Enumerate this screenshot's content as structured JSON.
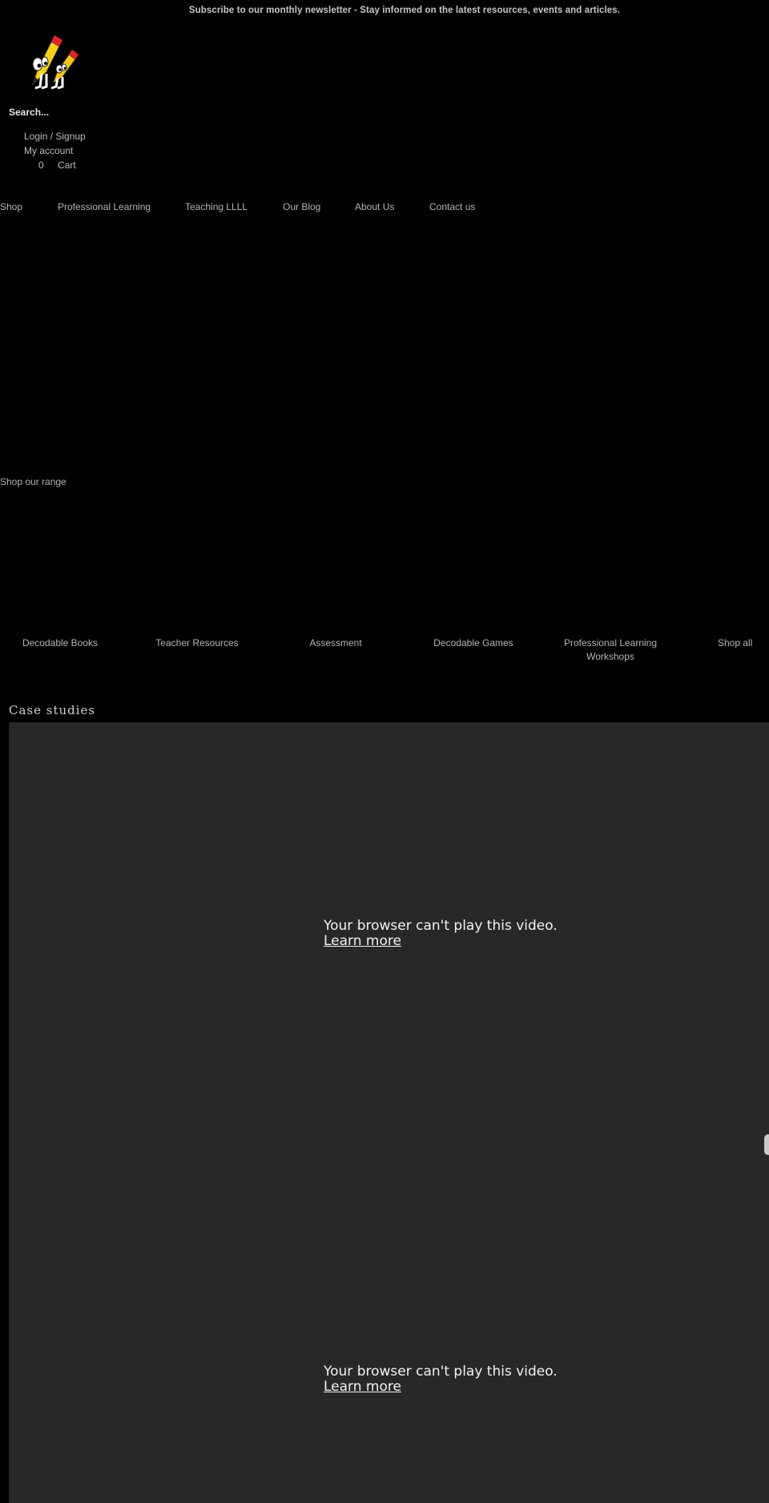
{
  "announcement": {
    "text": "Subscribe to our monthly newsletter - Stay informed on the latest resources, events and articles."
  },
  "header": {
    "logo_icon": "pencil-characters-logo",
    "search_label": "Search...",
    "login_label": "Login / Signup",
    "account_label": "My account",
    "cart_count": "0",
    "cart_label": "Cart"
  },
  "nav": {
    "items": [
      {
        "label": "Shop"
      },
      {
        "label": "Professional Learning"
      },
      {
        "label": "Teaching LLLL"
      },
      {
        "label": "Our Blog"
      },
      {
        "label": "About Us"
      },
      {
        "label": "Contact us"
      }
    ]
  },
  "shop_section": {
    "heading": "Shop our range",
    "ranges": [
      {
        "label": "Decodable Books"
      },
      {
        "label": "Teacher Resources"
      },
      {
        "label": "Assessment"
      },
      {
        "label": "Decodable Games"
      },
      {
        "label": "Professional Learning Workshops"
      },
      {
        "label": "Shop all"
      }
    ]
  },
  "case_studies": {
    "heading": "Case studies",
    "videos": [
      {
        "message": "Your browser can't play this video.",
        "link_label": "Learn more"
      },
      {
        "message": "Your browser can't play this video.",
        "link_label": "Learn more"
      }
    ]
  },
  "colors": {
    "background": "#000000",
    "video_background": "#282828",
    "text_muted": "#b5b5b5",
    "text_light": "#f2f2f2"
  }
}
